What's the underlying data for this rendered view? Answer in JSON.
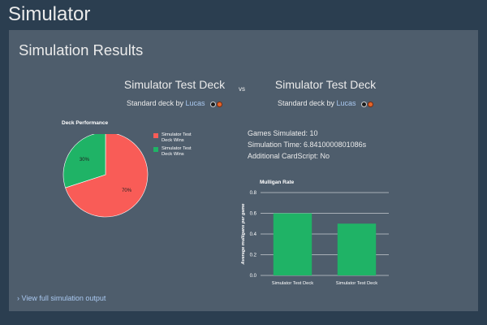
{
  "header": {
    "title": "Simulator"
  },
  "panel": {
    "title": "Simulation Results"
  },
  "decks": [
    {
      "name": "Simulator Test Deck",
      "subtitle_prefix": "Standard deck by",
      "author": "Lucas"
    },
    {
      "name": "Simulator Test Deck",
      "subtitle_prefix": "Standard deck by",
      "author": "Lucas"
    }
  ],
  "vs_label": "vs",
  "stats": {
    "games_simulated": "Games Simulated: 10",
    "simulation_time": "Simulation Time: 6.8410000801086s",
    "cardscript": "Additional CardScript: No"
  },
  "link": {
    "full_output": "View full simulation output"
  },
  "icons": {
    "link_chevron": "chevron-right-icon",
    "deck_icons": [
      "skull-icon",
      "fire-icon"
    ]
  },
  "colors": {
    "red": "#f95c57",
    "green": "#1fb366"
  },
  "chart_data": [
    {
      "type": "pie",
      "title": "Deck Performance",
      "slices": [
        {
          "label": "Simulator Test Deck Wins",
          "value": 70,
          "color": "#f95c57"
        },
        {
          "label": "Simulator Test Deck Wins",
          "value": 30,
          "color": "#1fb366"
        }
      ],
      "slice_labels": [
        "70%",
        "30%"
      ],
      "legend": "right"
    },
    {
      "type": "bar",
      "title": "Mulligan Rate",
      "ylabel": "Average mulligans per game",
      "categories": [
        "Simulator Test Deck",
        "Simulator Test Deck"
      ],
      "values": [
        0.6,
        0.5
      ],
      "ylim": [
        0,
        0.8
      ],
      "yticks": [
        "0.0",
        "0.2",
        "0.4",
        "0.6",
        "0.8"
      ],
      "color": "#1fb366",
      "grid": true
    }
  ]
}
